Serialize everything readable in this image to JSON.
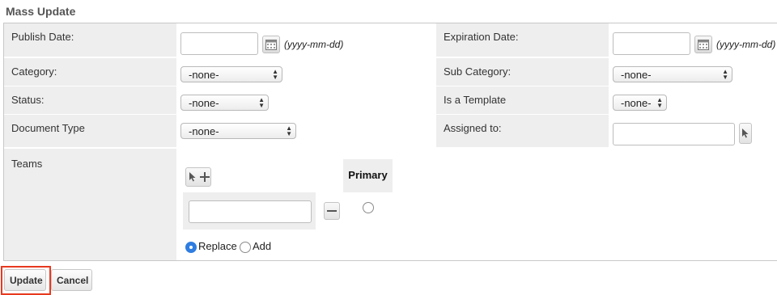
{
  "title": "Mass Update",
  "fields": {
    "publish_date": {
      "label": "Publish Date:",
      "value": "",
      "format_hint": "(yyyy-mm-dd)"
    },
    "expiration_date": {
      "label": "Expiration Date:",
      "value": "",
      "format_hint": "(yyyy-mm-dd)"
    },
    "category": {
      "label": "Category:",
      "selected": "-none-"
    },
    "sub_category": {
      "label": "Sub Category:",
      "selected": "-none-"
    },
    "status": {
      "label": "Status:",
      "selected": "-none-"
    },
    "is_template": {
      "label": "Is a Template",
      "selected": "-none-"
    },
    "document_type": {
      "label": "Document Type",
      "selected": "-none-"
    },
    "assigned_to": {
      "label": "Assigned to:",
      "value": ""
    },
    "teams": {
      "label": "Teams",
      "primary_label": "Primary",
      "team_value": "",
      "mode_options": [
        {
          "label": "Replace",
          "checked": true
        },
        {
          "label": "Add",
          "checked": false
        }
      ]
    }
  },
  "actions": {
    "update_label": "Update",
    "cancel_label": "Cancel"
  },
  "colors": {
    "highlight": "#e8391f",
    "radio_accent": "#2f7de1",
    "label_bg": "#eeeeee"
  },
  "icons": [
    "calendar-icon",
    "select-arrow-icon",
    "pointer-icon",
    "plus-icon",
    "minus-icon"
  ]
}
